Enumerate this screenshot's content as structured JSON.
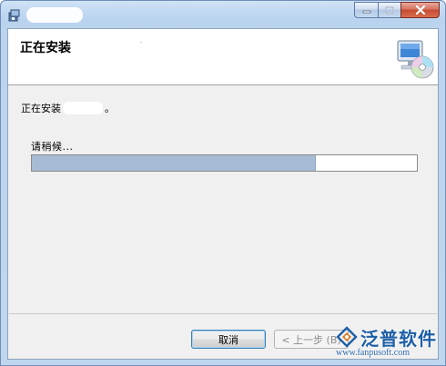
{
  "window": {
    "title": "",
    "controls": {
      "minimize_icon": "minimize-icon",
      "maximize_icon": "maximize-icon",
      "close_icon": "close-icon"
    }
  },
  "header": {
    "title": "正在安装",
    "icon": "computer-cd-icon"
  },
  "body": {
    "status_prefix": "正在安装",
    "status_app": "",
    "status_suffix": "。",
    "wait_label": "请稍候...",
    "progress": {
      "fraction": 0.737,
      "fill_color": "#a7bcd4"
    }
  },
  "buttons": {
    "cancel": "取消",
    "back": "< 上一步 (B)"
  },
  "watermark": {
    "brand": "泛普软件",
    "url": "www.fanpusoft.com"
  }
}
